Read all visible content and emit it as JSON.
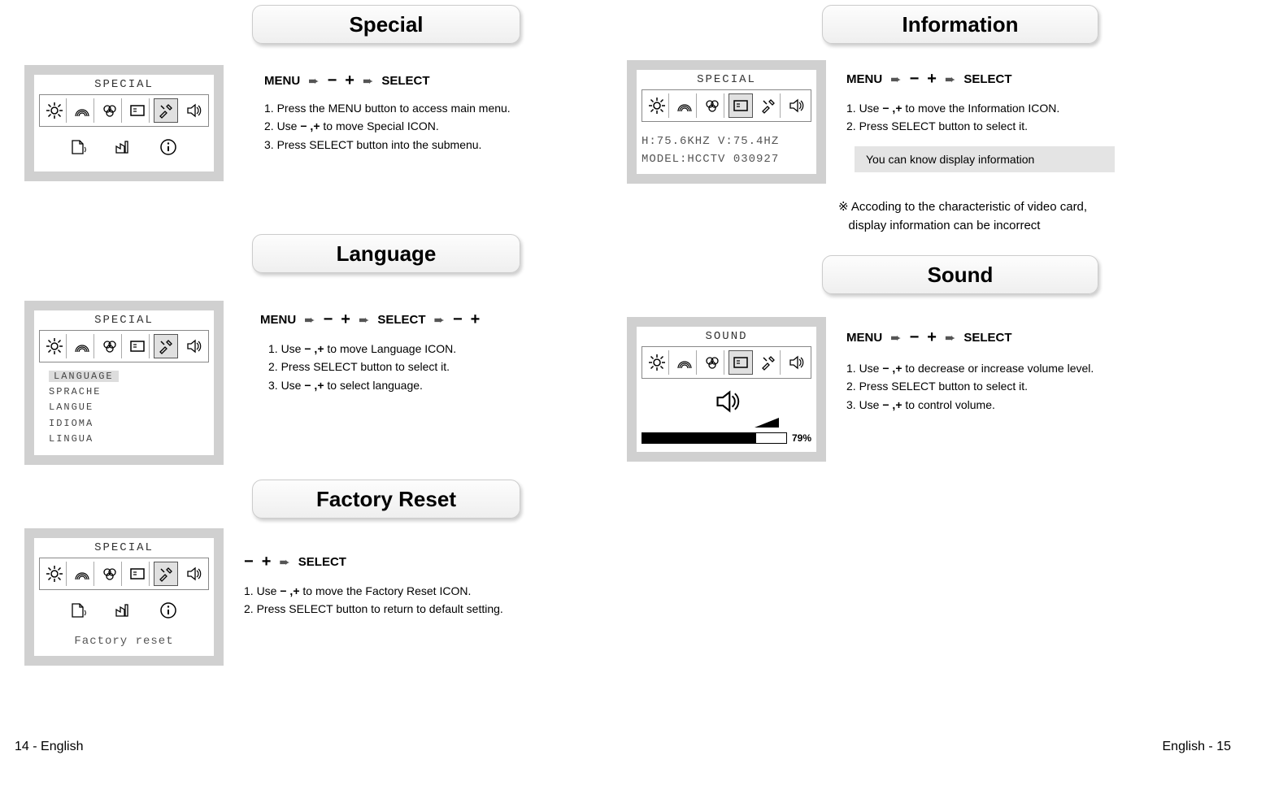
{
  "titles": {
    "special": "Special",
    "language": "Language",
    "factory": "Factory Reset",
    "information": "Information",
    "sound": "Sound"
  },
  "nav": {
    "menu": "MENU",
    "select": "SELECT",
    "arrow": "➨",
    "minus": "−",
    "plus": "+"
  },
  "special": {
    "osd_title": "SPECIAL",
    "step1": "1. Press the MENU button to access main menu.",
    "step2_a": "2. Use ",
    "step2_b": " to move Special ICON.",
    "step3": "3. Press SELECT button into the submenu."
  },
  "language": {
    "osd_title": "SPECIAL",
    "items": [
      "LANGUAGE",
      "SPRACHE",
      "LANGUE",
      "IDIOMA",
      "LINGUA"
    ],
    "step1_a": "1. Use ",
    "step1_b": " to move Language ICON.",
    "step2": "2. Press SELECT button to select it.",
    "step3_a": "3. Use ",
    "step3_b": " to select language."
  },
  "factory": {
    "osd_title": "SPECIAL",
    "label": "Factory reset",
    "step1_a": "1. Use ",
    "step1_b": " to move the Factory Reset ICON.",
    "step2": "2. Press SELECT button to return to default setting."
  },
  "info": {
    "osd_title": "SPECIAL",
    "line1": "H:75.6KHZ   V:75.4HZ",
    "line2": "MODEL:HCCTV 030927",
    "step1_a": "1. Use ",
    "step1_b": " to move the Information ICON.",
    "step2": "2. Press SELECT button to select it.",
    "note": "You can know display information",
    "footnote_sym": "※",
    "footnote1": "Accoding to the characteristic of video card,",
    "footnote2": "display information can be incorrect"
  },
  "sound": {
    "osd_title": "SOUND",
    "pct": "79%",
    "step1_a": "1. Use ",
    "step1_b": " to decrease or increase volume level.",
    "step2": "2. Press SELECT button to select it.",
    "step3_a": "3. Use ",
    "step3_b": " to control volume."
  },
  "pmtext": "− ,+",
  "pager": {
    "left": "14 - English",
    "right": "English - 15"
  },
  "chart_data": {
    "type": "bar",
    "title": "Sound Volume",
    "categories": [
      "Volume"
    ],
    "values": [
      79
    ],
    "ylim": [
      0,
      100
    ],
    "xlabel": "",
    "ylabel": "%"
  }
}
